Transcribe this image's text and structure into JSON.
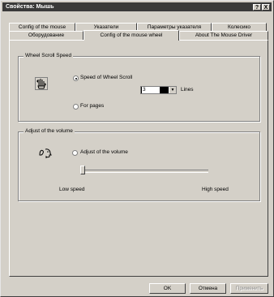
{
  "window": {
    "title": "Свойства: Мышь",
    "help_button": "?",
    "close_button": "X"
  },
  "tabs": {
    "row1": [
      "Config of the mouse",
      "Указатели",
      "Параметры указателя",
      "Колесико"
    ],
    "row2": [
      "Оборудование",
      "Config of the mouse wheel",
      "About The Mouse Driver"
    ],
    "active": "Config of the mouse wheel"
  },
  "wheel_scroll": {
    "group_label": "Wheel Scroll Speed",
    "speed_option": "Speed of Wheel Scroll",
    "speed_value": "3",
    "lines_label": "Lines",
    "pages_option": "For pages",
    "icon": "mouse-wheel-icon"
  },
  "volume": {
    "group_label": "Adjust of the volume",
    "option": "Adjust of the volume",
    "low_label": "Low speed",
    "high_label": "High speed",
    "slider_level": 0.0,
    "icon": "speaker-head-icon"
  },
  "buttons": {
    "ok": "OK",
    "cancel": "Отмена",
    "apply": "Применить"
  }
}
